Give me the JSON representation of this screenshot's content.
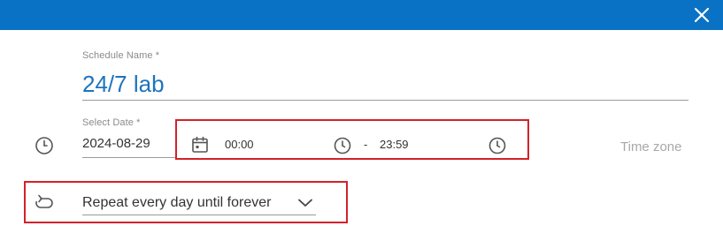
{
  "dialog": {
    "close_icon": "close-icon",
    "title_bar_color": "#0a72c4"
  },
  "schedule_name": {
    "label": "Schedule Name *",
    "value": "24/7 lab"
  },
  "select_date": {
    "label": "Select Date *",
    "value": "2024-08-29",
    "date_icon": "calendar-icon",
    "row_icon": "clock-icon"
  },
  "time_range": {
    "start": "00:00",
    "separator": "-",
    "end": "23:59"
  },
  "time_zone": {
    "label": "Time zone"
  },
  "repeat": {
    "icon": "repeat-icon",
    "value": "Repeat every day until forever",
    "dropdown_icon": "chevron-down-icon"
  },
  "highlight_color": "#d4212b",
  "accent_color": "#1e73be"
}
